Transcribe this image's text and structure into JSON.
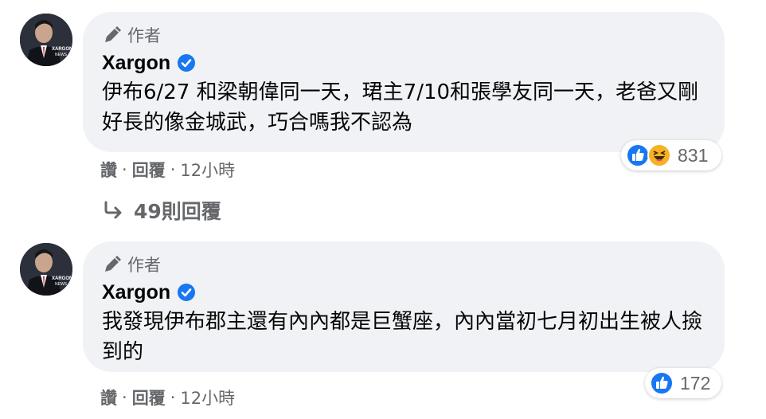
{
  "comments": [
    {
      "author_badge": "作者",
      "author_name": "Xargon",
      "avatar_text": "XARGON NEWS",
      "text": "伊布6/27 和梁朝偉同一天，珺主7/10和張學友同一天，老爸又剛好長的像金城武，巧合嗎我不認為",
      "reaction_icons": [
        "like-icon",
        "haha-icon"
      ],
      "reaction_count": "831",
      "actions": {
        "like": "讚",
        "reply": "回覆",
        "time": "12小時",
        "separator": "·"
      }
    },
    {
      "author_badge": "作者",
      "author_name": "Xargon",
      "avatar_text": "XARGON NEWS",
      "text": "我發現伊布郡主還有內內都是巨蟹座，內內當初七月初出生被人撿到的",
      "reaction_icons": [
        "like-icon"
      ],
      "reaction_count": "172",
      "actions": {
        "like": "讚",
        "reply": "回覆",
        "time": "12小時",
        "separator": "·"
      }
    }
  ],
  "replies_link": "49則回覆",
  "colors": {
    "like_blue": "#1877f2",
    "haha_yellow": "#f7b125",
    "bubble_bg": "#f0f2f5",
    "secondary_text": "#65676b"
  }
}
